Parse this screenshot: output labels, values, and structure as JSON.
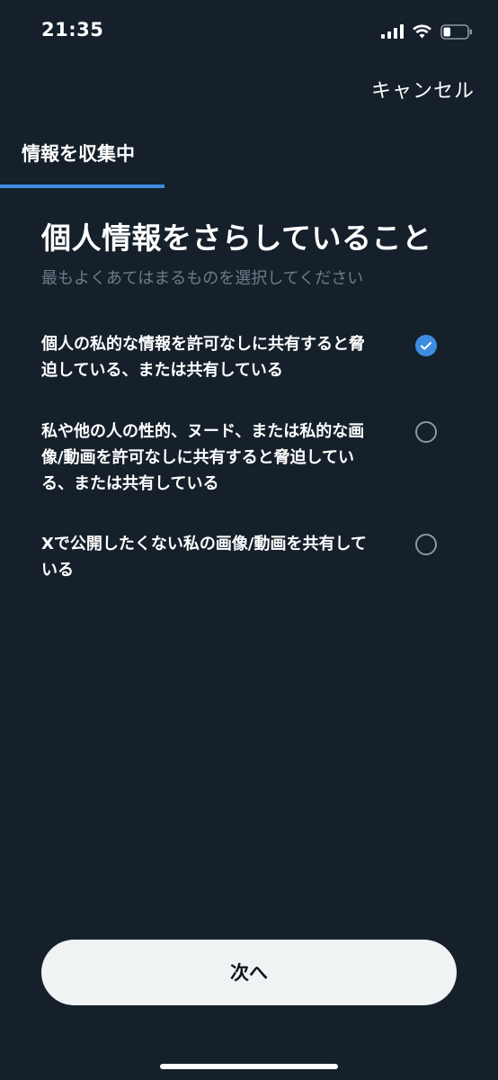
{
  "status_bar": {
    "time": "21:35",
    "signal_icon": "cellular-signal-icon",
    "wifi_icon": "wifi-icon",
    "battery_icon": "battery-icon",
    "battery_level": 0.3
  },
  "header": {
    "cancel_label": "キャンセル"
  },
  "progress": {
    "title": "情報を収集中",
    "fraction": 0.33,
    "accent_color": "#3d8ce0"
  },
  "main": {
    "heading": "個人情報をさらしていること",
    "subheading": "最もよくあてはまるものを選択してください",
    "options": [
      {
        "label": "個人の私的な情報を許可なしに共有すると脅迫している、または共有している",
        "selected": true
      },
      {
        "label": "私や他の人の性的、ヌード、または私的な画像/動画を許可なしに共有すると脅迫している、または共有している",
        "selected": false
      },
      {
        "label": "Xで公開したくない私の画像/動画を共有している",
        "selected": false
      }
    ]
  },
  "footer": {
    "next_label": "次へ"
  },
  "colors": {
    "background": "#15202b",
    "button_bg": "#eff3f4",
    "subtext": "#6e7b88"
  }
}
